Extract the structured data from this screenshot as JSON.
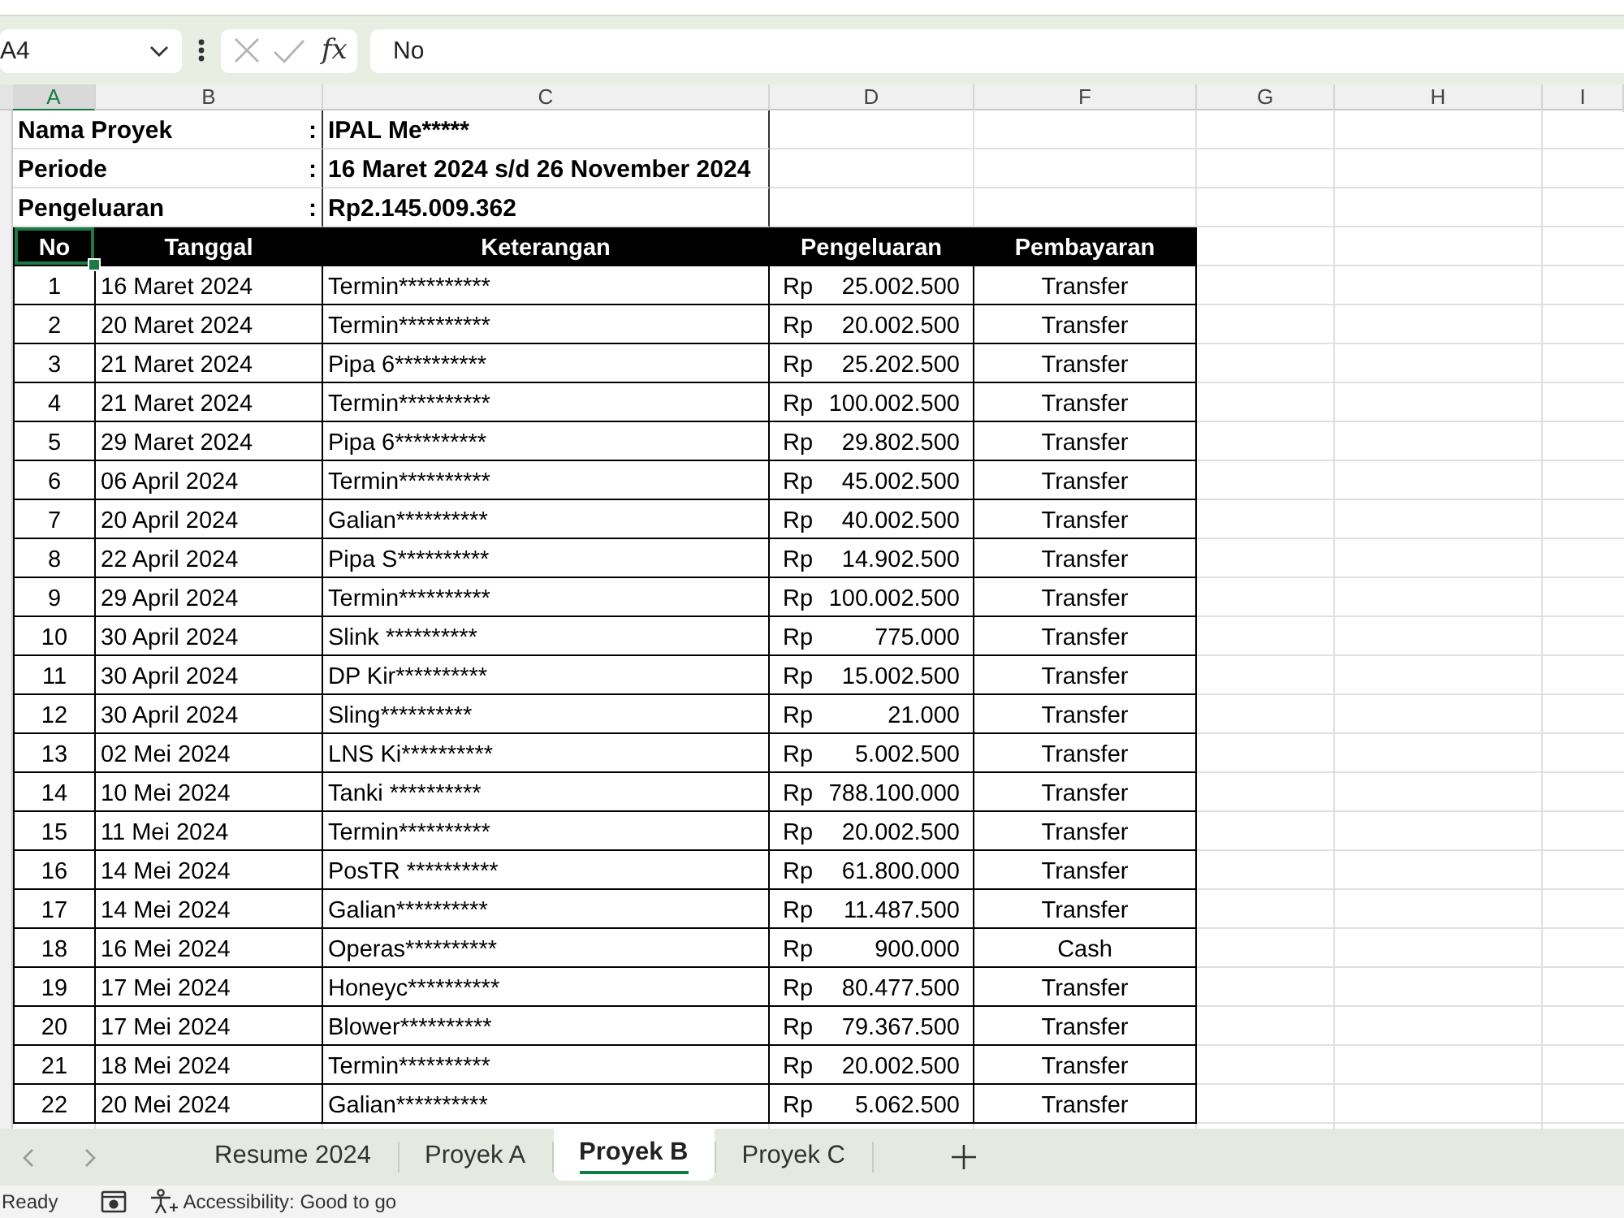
{
  "formula_bar": {
    "name_box": "A4",
    "function_label": "fx",
    "formula": "No"
  },
  "columns": [
    {
      "label": "A",
      "selected": true
    },
    {
      "label": "B",
      "selected": false
    },
    {
      "label": "C",
      "selected": false
    },
    {
      "label": "D",
      "selected": false
    },
    {
      "label": "F",
      "selected": false
    },
    {
      "label": "G",
      "selected": false
    },
    {
      "label": "H",
      "selected": false
    },
    {
      "label": "I",
      "selected": false
    }
  ],
  "project_info": [
    {
      "label": "Nama Proyek",
      "separator": ":",
      "value": "IPAL Me*****"
    },
    {
      "label": "Periode",
      "separator": ":",
      "value": "16 Maret 2024 s/d 26 November 2024"
    },
    {
      "label": "Pengeluaran",
      "separator": ":",
      "value": "Rp2.145.009.362"
    }
  ],
  "table": {
    "columns": [
      {
        "label": "No",
        "selected": true
      },
      {
        "label": "Tanggal",
        "selected": false
      },
      {
        "label": "Keterangan",
        "selected": false
      },
      {
        "label": "Pengeluaran",
        "selected": false
      },
      {
        "label": "Pembayaran",
        "selected": false
      }
    ],
    "rows": [
      {
        "no": "1",
        "date": "16 Maret 2024",
        "description": "Termin**********",
        "currency": "Rp",
        "amount": "25.002.500",
        "payment": "Transfer"
      },
      {
        "no": "2",
        "date": "20 Maret 2024",
        "description": "Termin**********",
        "currency": "Rp",
        "amount": "20.002.500",
        "payment": "Transfer"
      },
      {
        "no": "3",
        "date": "21 Maret 2024",
        "description": "Pipa 6**********",
        "currency": "Rp",
        "amount": "25.202.500",
        "payment": "Transfer"
      },
      {
        "no": "4",
        "date": "21 Maret 2024",
        "description": "Termin**********",
        "currency": "Rp",
        "amount": "100.002.500",
        "payment": "Transfer"
      },
      {
        "no": "5",
        "date": "29 Maret 2024",
        "description": "Pipa 6**********",
        "currency": "Rp",
        "amount": "29.802.500",
        "payment": "Transfer"
      },
      {
        "no": "6",
        "date": "06 April 2024",
        "description": "Termin**********",
        "currency": "Rp",
        "amount": "45.002.500",
        "payment": "Transfer"
      },
      {
        "no": "7",
        "date": "20 April 2024",
        "description": "Galian**********",
        "currency": "Rp",
        "amount": "40.002.500",
        "payment": "Transfer"
      },
      {
        "no": "8",
        "date": "22 April 2024",
        "description": "Pipa S**********",
        "currency": "Rp",
        "amount": "14.902.500",
        "payment": "Transfer"
      },
      {
        "no": "9",
        "date": "29 April 2024",
        "description": "Termin**********",
        "currency": "Rp",
        "amount": "100.002.500",
        "payment": "Transfer"
      },
      {
        "no": "10",
        "date": "30 April 2024",
        "description": "Slink **********",
        "currency": "Rp",
        "amount": "775.000",
        "payment": "Transfer"
      },
      {
        "no": "11",
        "date": "30 April 2024",
        "description": "DP Kir**********",
        "currency": "Rp",
        "amount": "15.002.500",
        "payment": "Transfer"
      },
      {
        "no": "12",
        "date": "30 April 2024",
        "description": "Sling**********",
        "currency": "Rp",
        "amount": "21.000",
        "payment": "Transfer"
      },
      {
        "no": "13",
        "date": "02 Mei 2024",
        "description": "LNS Ki**********",
        "currency": "Rp",
        "amount": "5.002.500",
        "payment": "Transfer"
      },
      {
        "no": "14",
        "date": "10 Mei 2024",
        "description": "Tanki **********",
        "currency": "Rp",
        "amount": "788.100.000",
        "payment": "Transfer"
      },
      {
        "no": "15",
        "date": "11 Mei 2024",
        "description": "Termin**********",
        "currency": "Rp",
        "amount": "20.002.500",
        "payment": "Transfer"
      },
      {
        "no": "16",
        "date": "14 Mei 2024",
        "description": "PosTR **********",
        "currency": "Rp",
        "amount": "61.800.000",
        "payment": "Transfer"
      },
      {
        "no": "17",
        "date": "14 Mei 2024",
        "description": "Galian**********",
        "currency": "Rp",
        "amount": "11.487.500",
        "payment": "Transfer"
      },
      {
        "no": "18",
        "date": "16 Mei 2024",
        "description": "Operas**********",
        "currency": "Rp",
        "amount": "900.000",
        "payment": "Cash"
      },
      {
        "no": "19",
        "date": "17 Mei 2024",
        "description": "Honeyc**********",
        "currency": "Rp",
        "amount": "80.477.500",
        "payment": "Transfer"
      },
      {
        "no": "20",
        "date": "17 Mei 2024",
        "description": "Blower**********",
        "currency": "Rp",
        "amount": "79.367.500",
        "payment": "Transfer"
      },
      {
        "no": "21",
        "date": "18 Mei 2024",
        "description": "Termin**********",
        "currency": "Rp",
        "amount": "20.002.500",
        "payment": "Transfer"
      },
      {
        "no": "22",
        "date": "20 Mei 2024",
        "description": "Galian**********",
        "currency": "Rp",
        "amount": "5.062.500",
        "payment": "Transfer"
      }
    ]
  },
  "sheet_tabs": [
    {
      "label": "Resume 2024",
      "selected": false
    },
    {
      "label": "Proyek A",
      "selected": false
    },
    {
      "label": "Proyek B",
      "selected": true
    },
    {
      "label": "Proyek C",
      "selected": false
    }
  ],
  "status_bar": {
    "mode": "Ready",
    "accessibility": "Accessibility: Good to go"
  }
}
